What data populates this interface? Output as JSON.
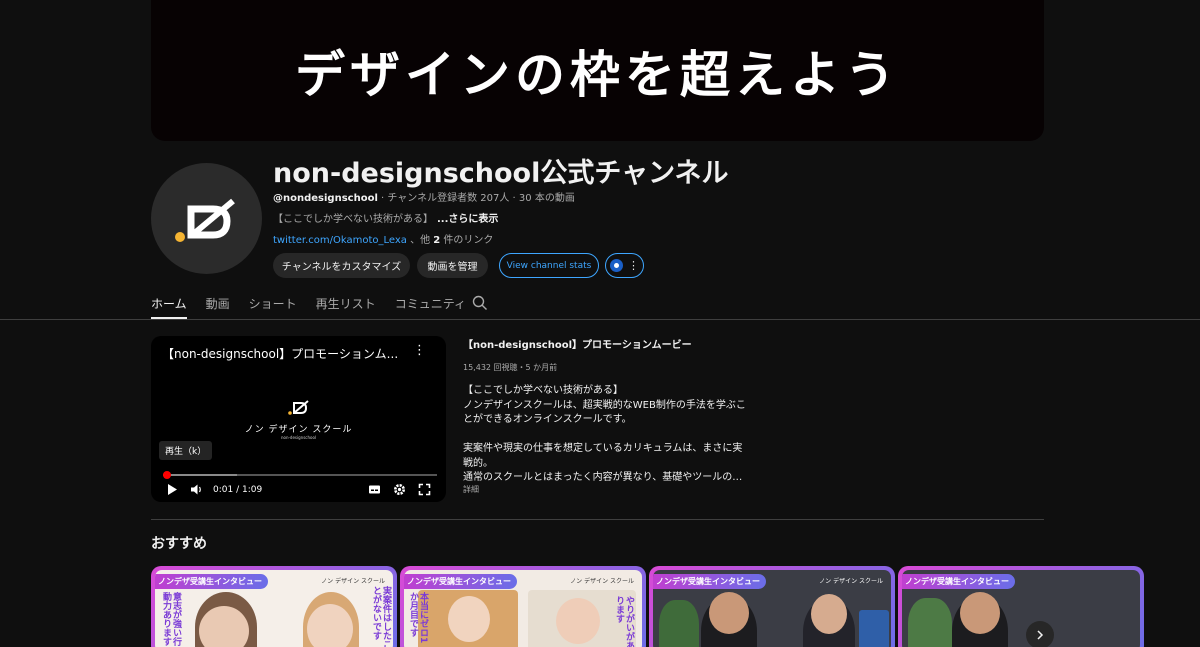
{
  "banner": {
    "text": "デザインの枠を超えよう"
  },
  "channel": {
    "name": "non-designschool公式チャンネル",
    "handle": "@nondesignschool",
    "stats": " · チャンネル登録者数 207人 · 30 本の動画",
    "description": "【ここでしか学べない技術がある】",
    "more_label": "...さらに表示",
    "link_text": "twitter.com/Okamoto_Lexa",
    "link_suffix_pre": " 、他 ",
    "link_count": "2",
    "link_suffix_post": " 件のリンク",
    "avatar_accent": "#f6b533"
  },
  "buttons": {
    "customize": "チャンネルをカスタマイズ",
    "manage": "動画を管理",
    "stats": "View channel stats",
    "more": "⋮"
  },
  "tabs": [
    {
      "label": "ホーム",
      "active": true
    },
    {
      "label": "動画"
    },
    {
      "label": "ショート"
    },
    {
      "label": "再生リスト"
    },
    {
      "label": "コミュニティ"
    }
  ],
  "player": {
    "title": "【non-designschool】プロモーションム...",
    "logo_jp": "ノン デザイン スクール",
    "logo_en": "non-designschool",
    "tooltip": "再生（k）",
    "time": "0:01 / 1:09",
    "played_fraction": 0.015,
    "buffered_fraction": 0.27
  },
  "featured": {
    "title": "【non-designschool】プロモーションムービー",
    "meta": "15,432 回視聴・5 か月前",
    "description": [
      "【ここでしか学べない技術がある】",
      "ノンデザインスクールは、超実戦的なWEB制作の手法を学ぶこ",
      "とができるオンラインスクールです。",
      "",
      "実案件や現実の仕事を想定しているカリキュラムは、まさに実",
      "戦的。",
      "通常のスクールとはまったく内容が異なり、基礎やツールの…"
    ],
    "detail_label": "詳細"
  },
  "recommended": {
    "title": "おすすめ",
    "cards": [
      {
        "tag": "ノンデザ受講生インタビュー",
        "brand": "ノン デザイン スクール",
        "theme": "light",
        "text_left": "意志が強い行動力あります",
        "text_right": "実案件はしたことがないです"
      },
      {
        "tag": "ノンデザ受講生インタビュー",
        "brand": "ノン デザイン スクール",
        "theme": "light",
        "text_left": "本当にゼロ1か月目です",
        "text_right": "やりがいがあります"
      },
      {
        "tag": "ノンデザ受講生インタビュー",
        "brand": "ノン デザイン スクール",
        "theme": "dark"
      },
      {
        "tag": "ノンデザ受講生インタビュー",
        "brand": "",
        "theme": "dark"
      }
    ]
  }
}
